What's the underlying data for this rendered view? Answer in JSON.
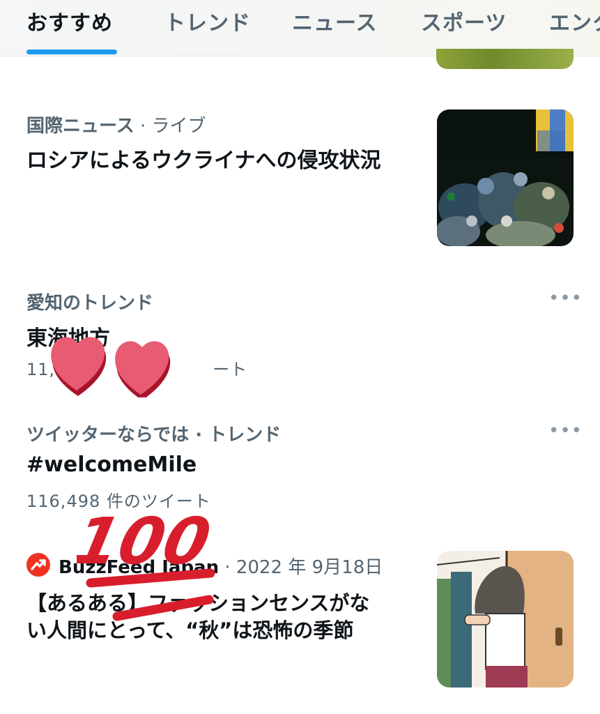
{
  "tabs": [
    {
      "label": "おすすめ",
      "active": true
    },
    {
      "label": "トレンド"
    },
    {
      "label": "ニュース"
    },
    {
      "label": "スポーツ"
    },
    {
      "label": "エンタ"
    }
  ],
  "colors": {
    "accent": "#1d9bf0",
    "text": "#0f1419",
    "secondary": "#536471",
    "heart": "#e85c73",
    "sticker_red": "#d81e2c"
  },
  "items": [
    {
      "category": "国際ニュース",
      "separator": "·",
      "status": "ライブ",
      "title": "ロシアによるウクライナへの侵攻状況",
      "thumbnail": "ukraine-memorial-photo"
    },
    {
      "category": "愛知のトレンド",
      "title": "東海地方",
      "count_prefix": "11,",
      "count_mid": "件の",
      "count_suffix": "ート",
      "more": "•••"
    },
    {
      "category": "ツイッターならでは · トレンド",
      "title": "#welcomeMile",
      "count": "116,498 件のツイート",
      "more": "•••"
    },
    {
      "source": "BuzzFeed Japan",
      "date": "· 2022 年 9月18日",
      "title_line1": "【あるある】ファッションセンスがな",
      "title_line2": "い人間にとって、“秋”は恐怖の季節",
      "thumbnail": "comic-illustration"
    }
  ],
  "stickers": {
    "hundred": "100",
    "hearts": "heart-sticker"
  }
}
